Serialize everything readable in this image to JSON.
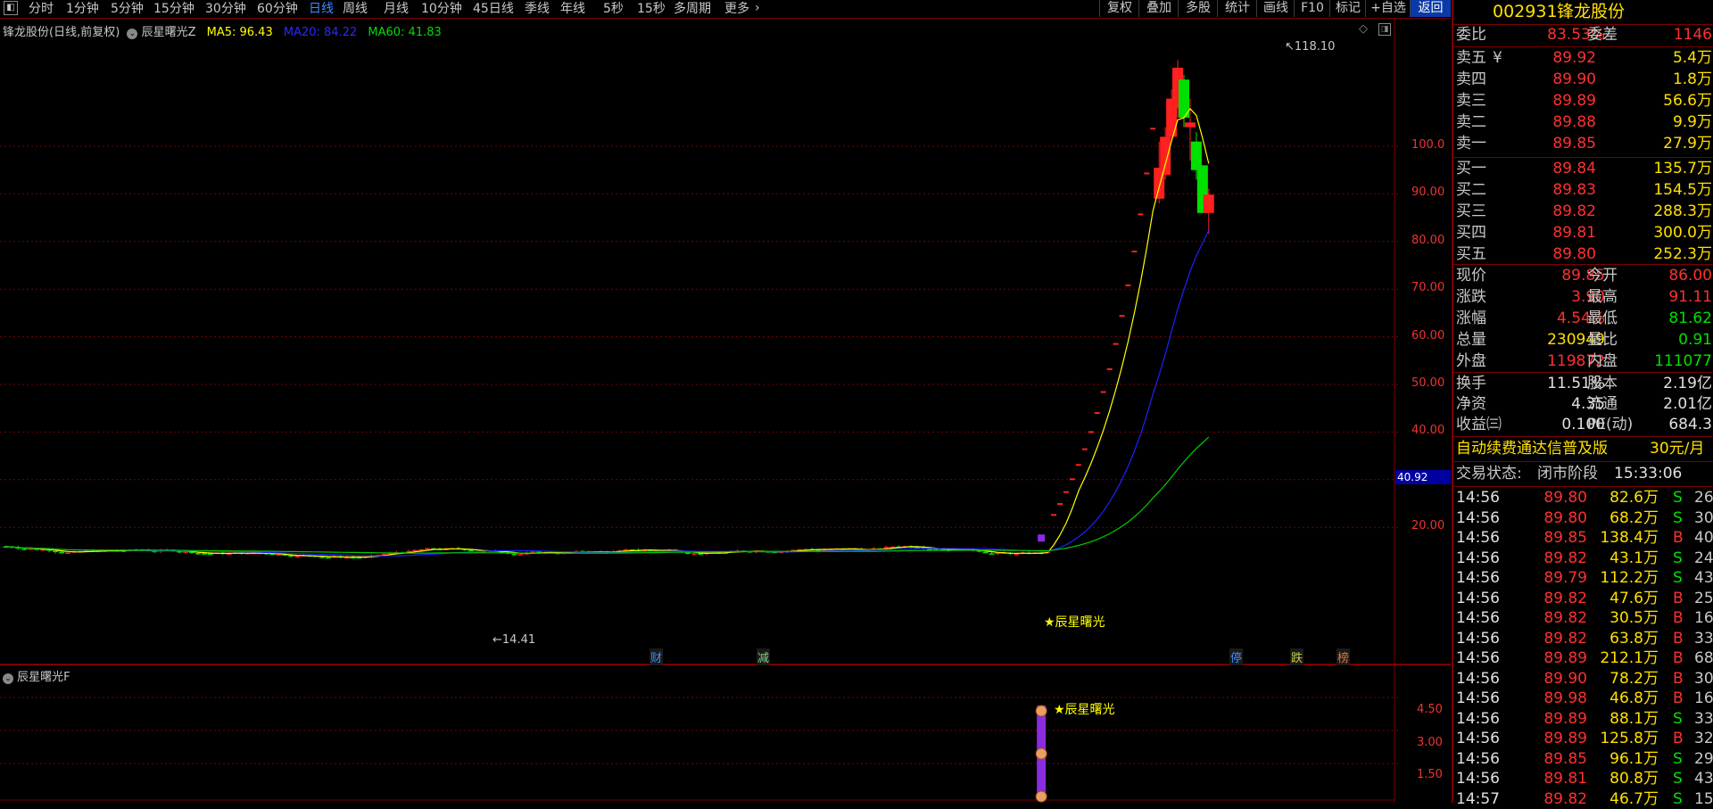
{
  "toolbar": {
    "tabs": [
      "分时",
      "1分钟",
      "5分钟",
      "15分钟",
      "30分钟",
      "60分钟",
      "日线",
      "周线",
      "月线",
      "10分钟",
      "45日线",
      "季线",
      "年线",
      "5秒",
      "15秒",
      "多周期",
      "更多"
    ],
    "active_tab": "日线",
    "right_buttons": [
      "复权",
      "叠加",
      "多股",
      "统计",
      "画线",
      "F10",
      "标记",
      "+自选",
      "返回"
    ]
  },
  "main_chart": {
    "stock_label": "锋龙股份(日线,前复权)",
    "indicator_name": "辰星曙光Z",
    "ma5": "MA5: 96.43",
    "ma20": "MA20: 84.22",
    "ma60": "MA60: 41.83",
    "high_label": "118.10",
    "low_label": "14.41",
    "signal_label": "★辰星曙光",
    "cursor_price": "40.92",
    "y_ticks": [
      "100.0",
      "90.00",
      "80.00",
      "70.00",
      "60.00",
      "50.00",
      "40.00",
      "30.00",
      "20.00"
    ],
    "event_markers": [
      "财",
      "减",
      "停",
      "跌",
      "榜"
    ],
    "colors": {
      "up": "#ff2020",
      "down": "#00e000",
      "ma5": "#ffff00",
      "ma20": "#2020ff",
      "ma60": "#00cc00",
      "grid": "#7a0000"
    }
  },
  "sub_chart": {
    "indicator_name": "辰星曙光F",
    "signal_label": "★辰星曙光",
    "y_ticks": [
      "4.50",
      "3.00",
      "1.50"
    ]
  },
  "chart_data": {
    "type": "candlestick",
    "ylim": [
      10,
      125
    ],
    "ma_values": {
      "MA5": 96.43,
      "MA20": 84.22,
      "MA60": 41.83
    },
    "recent_candles": [
      {
        "open": 20.5,
        "close": 22.6,
        "high": 22.6,
        "low": 20.5
      },
      {
        "open": 22.6,
        "close": 24.9,
        "high": 24.9,
        "low": 22.6
      },
      {
        "open": 24.9,
        "close": 27.4,
        "high": 27.4,
        "low": 24.9
      },
      {
        "open": 27.4,
        "close": 30.1,
        "high": 30.1,
        "low": 27.4
      },
      {
        "open": 30.1,
        "close": 33.1,
        "high": 33.1,
        "low": 30.1
      },
      {
        "open": 33.1,
        "close": 36.4,
        "high": 36.4,
        "low": 33.1
      },
      {
        "open": 36.4,
        "close": 40.0,
        "high": 40.0,
        "low": 36.4
      },
      {
        "open": 40.0,
        "close": 44.0,
        "high": 44.0,
        "low": 40.0
      },
      {
        "open": 44.0,
        "close": 48.4,
        "high": 48.4,
        "low": 44.0
      },
      {
        "open": 48.4,
        "close": 53.2,
        "high": 53.2,
        "low": 48.4
      },
      {
        "open": 53.2,
        "close": 58.5,
        "high": 58.5,
        "low": 53.2
      },
      {
        "open": 58.5,
        "close": 64.4,
        "high": 64.4,
        "low": 58.5
      },
      {
        "open": 64.4,
        "close": 70.8,
        "high": 70.8,
        "low": 64.4
      },
      {
        "open": 70.8,
        "close": 77.9,
        "high": 77.9,
        "low": 70.8
      },
      {
        "open": 77.9,
        "close": 85.7,
        "high": 85.7,
        "low": 77.9
      },
      {
        "open": 85.7,
        "close": 94.3,
        "high": 94.3,
        "low": 85.7
      },
      {
        "open": 94.3,
        "close": 103.7,
        "high": 103.7,
        "low": 94.3
      },
      {
        "open": 89.0,
        "close": 95.5,
        "high": 101.0,
        "low": 88.0
      },
      {
        "open": 94.0,
        "close": 102.0,
        "high": 104.0,
        "low": 93.0
      },
      {
        "open": 102.0,
        "close": 110.0,
        "high": 112.0,
        "low": 101.0
      },
      {
        "open": 108.0,
        "close": 116.5,
        "high": 118.1,
        "low": 106.0
      },
      {
        "open": 114.0,
        "close": 106.0,
        "high": 115.0,
        "low": 104.0
      },
      {
        "open": 104.0,
        "close": 105.0,
        "high": 110.0,
        "low": 97.0
      },
      {
        "open": 101.0,
        "close": 95.0,
        "high": 103.0,
        "low": 93.0
      },
      {
        "open": 96.0,
        "close": 86.0,
        "high": 96.0,
        "low": 86.0
      },
      {
        "open": 86.0,
        "close": 89.85,
        "high": 91.11,
        "low": 81.62
      }
    ]
  },
  "panel": {
    "stock_code": "002931",
    "stock_name": "锋龙股份",
    "weibi_label": "委比",
    "weibi_value": "83.53%",
    "weicha_label": "委差",
    "weicha_value": "1146",
    "asks": [
      {
        "label": "卖五",
        "price": "89.92",
        "vol": "5.4万"
      },
      {
        "label": "卖四",
        "price": "89.90",
        "vol": "1.8万"
      },
      {
        "label": "卖三",
        "price": "89.89",
        "vol": "56.6万"
      },
      {
        "label": "卖二",
        "price": "89.88",
        "vol": "9.9万"
      },
      {
        "label": "卖一",
        "price": "89.85",
        "vol": "27.9万"
      }
    ],
    "ask5_symbol": "¥",
    "bids": [
      {
        "label": "买一",
        "price": "89.84",
        "vol": "135.7万"
      },
      {
        "label": "买二",
        "price": "89.83",
        "vol": "154.5万"
      },
      {
        "label": "买三",
        "price": "89.82",
        "vol": "288.3万"
      },
      {
        "label": "买四",
        "price": "89.81",
        "vol": "300.0万"
      },
      {
        "label": "买五",
        "price": "89.80",
        "vol": "252.3万"
      }
    ],
    "quote": [
      {
        "l1": "现价",
        "v1": "89.85",
        "c1": "red",
        "l2": "今开",
        "v2": "86.00",
        "c2": "red"
      },
      {
        "l1": "涨跌",
        "v1": "3.90",
        "c1": "red",
        "l2": "最高",
        "v2": "91.11",
        "c2": "red"
      },
      {
        "l1": "涨幅",
        "v1": "4.54%",
        "c1": "red",
        "l2": "最低",
        "v2": "81.62",
        "c2": "green"
      },
      {
        "l1": "总量",
        "v1": "230949",
        "c1": "yellow",
        "l2": "量比",
        "v2": "0.91",
        "c2": "green"
      },
      {
        "l1": "外盘",
        "v1": "119872",
        "c1": "red",
        "l2": "内盘",
        "v2": "111077",
        "c2": "green"
      }
    ],
    "fundamentals": [
      {
        "l1": "换手",
        "v1": "11.51%",
        "l2": "股本",
        "v2": "2.19亿"
      },
      {
        "l1": "净资",
        "v1": "4.35",
        "l2": "流通",
        "v2": "2.01亿"
      },
      {
        "l1": "收益㈢",
        "v1": "0.100",
        "l2": "PE(动)",
        "v2": "684.3"
      }
    ],
    "promo_text": "自动续费通达信普及版",
    "promo_price": "30元/月",
    "status_label": "交易状态:",
    "status_value": "闭市阶段",
    "status_time": "15:33:06",
    "ticks": [
      {
        "t": "14:56",
        "p": "89.80",
        "v": "82.6万",
        "d": "S",
        "n": "26"
      },
      {
        "t": "14:56",
        "p": "89.80",
        "v": "68.2万",
        "d": "S",
        "n": "30"
      },
      {
        "t": "14:56",
        "p": "89.85",
        "v": "138.4万",
        "d": "B",
        "n": "40"
      },
      {
        "t": "14:56",
        "p": "89.82",
        "v": "43.1万",
        "d": "S",
        "n": "24"
      },
      {
        "t": "14:56",
        "p": "89.79",
        "v": "112.2万",
        "d": "S",
        "n": "43"
      },
      {
        "t": "14:56",
        "p": "89.82",
        "v": "47.6万",
        "d": "B",
        "n": "25"
      },
      {
        "t": "14:56",
        "p": "89.82",
        "v": "30.5万",
        "d": "B",
        "n": "16"
      },
      {
        "t": "14:56",
        "p": "89.82",
        "v": "63.8万",
        "d": "B",
        "n": "33"
      },
      {
        "t": "14:56",
        "p": "89.89",
        "v": "212.1万",
        "d": "B",
        "n": "68"
      },
      {
        "t": "14:56",
        "p": "89.90",
        "v": "78.2万",
        "d": "B",
        "n": "30"
      },
      {
        "t": "14:56",
        "p": "89.98",
        "v": "46.8万",
        "d": "B",
        "n": "16"
      },
      {
        "t": "14:56",
        "p": "89.89",
        "v": "88.1万",
        "d": "S",
        "n": "33"
      },
      {
        "t": "14:56",
        "p": "89.89",
        "v": "125.8万",
        "d": "B",
        "n": "32"
      },
      {
        "t": "14:56",
        "p": "89.85",
        "v": "96.1万",
        "d": "S",
        "n": "29"
      },
      {
        "t": "14:56",
        "p": "89.81",
        "v": "80.8万",
        "d": "S",
        "n": "43"
      },
      {
        "t": "14:57",
        "p": "89.82",
        "v": "46.7万",
        "d": "S",
        "n": "15"
      }
    ]
  }
}
